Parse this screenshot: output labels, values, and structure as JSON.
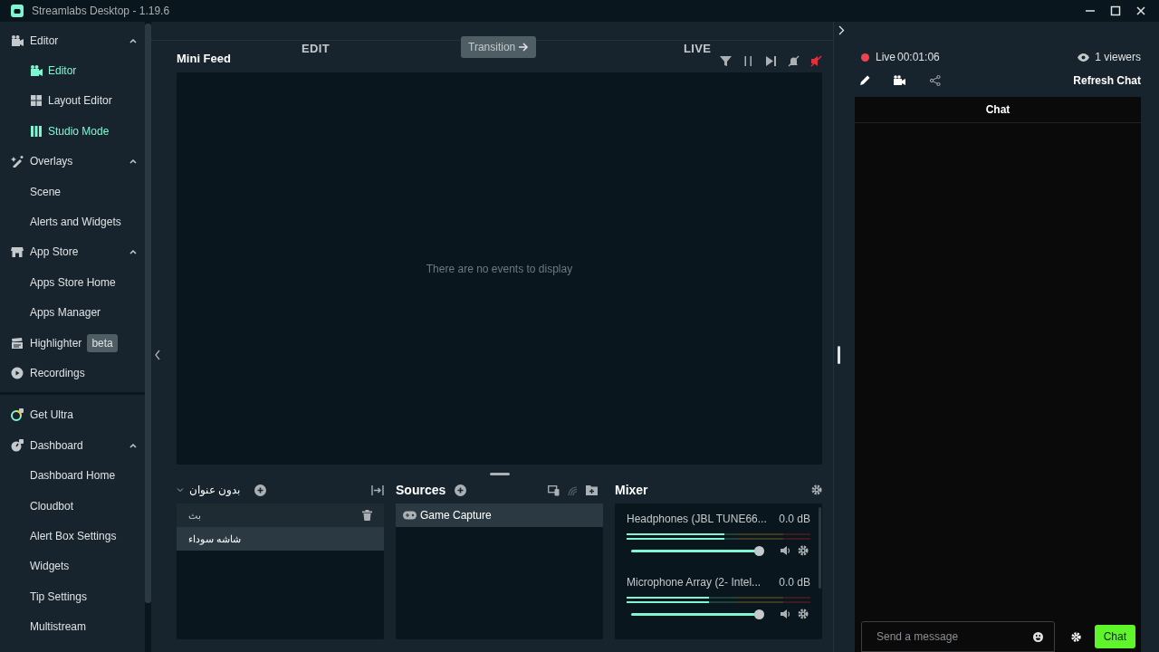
{
  "window": {
    "title": "Streamlabs Desktop - 1.19.6"
  },
  "sidebar": {
    "sections": [
      {
        "groups": [
          {
            "label": "Editor",
            "expanded": true,
            "children": [
              {
                "label": "Editor",
                "selected": true
              },
              {
                "label": "Layout Editor",
                "selected": false
              },
              {
                "label": "Studio Mode",
                "selected": true
              }
            ]
          },
          {
            "label": "Overlays",
            "expanded": true,
            "children": [
              {
                "label": "Scene",
                "selected": false
              },
              {
                "label": "Alerts and Widgets",
                "selected": false
              }
            ]
          },
          {
            "label": "App Store",
            "expanded": true,
            "children": [
              {
                "label": "Apps Store Home",
                "selected": false
              },
              {
                "label": "Apps Manager",
                "selected": false
              }
            ]
          },
          {
            "label": "Highlighter",
            "badge": "beta"
          },
          {
            "label": "Recordings"
          }
        ]
      },
      {
        "groups": [
          {
            "label": "Get Ultra"
          },
          {
            "label": "Dashboard",
            "expanded": true,
            "children": [
              {
                "label": "Dashboard Home",
                "selected": false
              },
              {
                "label": "Cloudbot",
                "selected": false
              },
              {
                "label": "Alert Box Settings",
                "selected": false
              },
              {
                "label": "Widgets",
                "selected": false
              },
              {
                "label": "Tip Settings",
                "selected": false
              },
              {
                "label": "Multistream",
                "selected": false
              }
            ]
          }
        ]
      }
    ]
  },
  "mode_bar": {
    "edit_label": "EDIT",
    "transition_button": "Transition",
    "live_label": "LIVE"
  },
  "mini_feed": {
    "title": "Mini Feed",
    "empty_text": "There are no events to display"
  },
  "scenes": {
    "title": "بدون عنوان",
    "items": [
      {
        "label": "بث",
        "selected": false
      },
      {
        "label": "شاشه سوداء",
        "selected": true
      }
    ]
  },
  "sources": {
    "title": "Sources",
    "items": [
      {
        "label": "Game Capture",
        "selected": true
      }
    ]
  },
  "mixer": {
    "title": "Mixer",
    "channels": [
      {
        "name": "Headphones (JBL TUNE66...",
        "reading": "0.0 dB",
        "meters": [
          {
            "level": 0.53
          },
          {
            "level": 0.53
          }
        ],
        "volume": {
          "level": 0.96
        },
        "muted": false
      },
      {
        "name": "Microphone Array (2- Intel...",
        "reading": "0.0 dB",
        "meters": [
          {
            "level": 0.45
          },
          {
            "level": 0.45
          }
        ],
        "volume": {
          "level": 0.96
        },
        "muted": false
      }
    ]
  },
  "chat_panel": {
    "live_label": "Live",
    "timer": "00:01:06",
    "viewers": "1 viewers",
    "refresh": "Refresh Chat",
    "chat_title": "Chat",
    "input": {
      "placeholder": "Send a message"
    },
    "send_button": "Chat"
  }
}
